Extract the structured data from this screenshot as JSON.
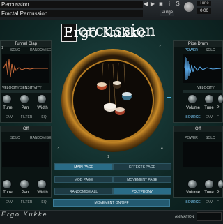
{
  "header": {
    "instrument_name": "Percussion",
    "preset_name": "Fractal Percussion",
    "purge_label": "Purge",
    "tune_label": "Tune",
    "tune_value": "0.00"
  },
  "title": {
    "text": "ercussion",
    "logo_letter": "P",
    "logo_sub": "Ergo Kukke"
  },
  "panels": {
    "top_left": {
      "title": "Tunnel Clap",
      "tabs": [
        "SOLO",
        "RANDOMISE"
      ],
      "velocity": "VELOCITY SENSITIVITY",
      "knobs": [
        "Tune",
        "Pan",
        "Width"
      ],
      "subtabs": [
        "ENV",
        "FILTER",
        "EQ"
      ],
      "corner": "1"
    },
    "top_right": {
      "title": "Pipe Drum",
      "tabs": [
        "POWER",
        "SOLO"
      ],
      "velocity": "VELOCITY SENS",
      "knobs": [
        "Volume",
        "Tune",
        "P"
      ],
      "subtabs": [
        "SOURCE",
        "ENV",
        "F"
      ],
      "corner": "2"
    },
    "bottom_left": {
      "title": "Off",
      "tabs": [
        "SOLO",
        "RANDOMISE"
      ],
      "knobs": [
        "Tune",
        "Pan",
        "Width"
      ],
      "subtabs": [
        "ENV",
        "FILTER",
        "EQ"
      ],
      "corner": "3"
    },
    "bottom_right": {
      "title": "Off",
      "tabs": [
        "POWER",
        "SOLO"
      ],
      "knobs": [
        "Volume",
        "Tune",
        "P"
      ],
      "subtabs": [
        "SOURCE",
        "ENV",
        "F"
      ],
      "corner": "4"
    }
  },
  "buttons": {
    "main_page": "MAIN PAGE",
    "effects_page": "EFFECTS PAGE",
    "mod_page": "MOD PAGE",
    "movement_page": "MOVEMENT PAGE",
    "randomise_all": "RANDOMISE ALL",
    "polyphony": "POLYPHONY",
    "movement_onoff": "MOVEMENT ON/OFF"
  },
  "center": {
    "marker": "1"
  },
  "footer": {
    "brand": "Ergo Kukke",
    "animation_label": "ANIMATION"
  }
}
